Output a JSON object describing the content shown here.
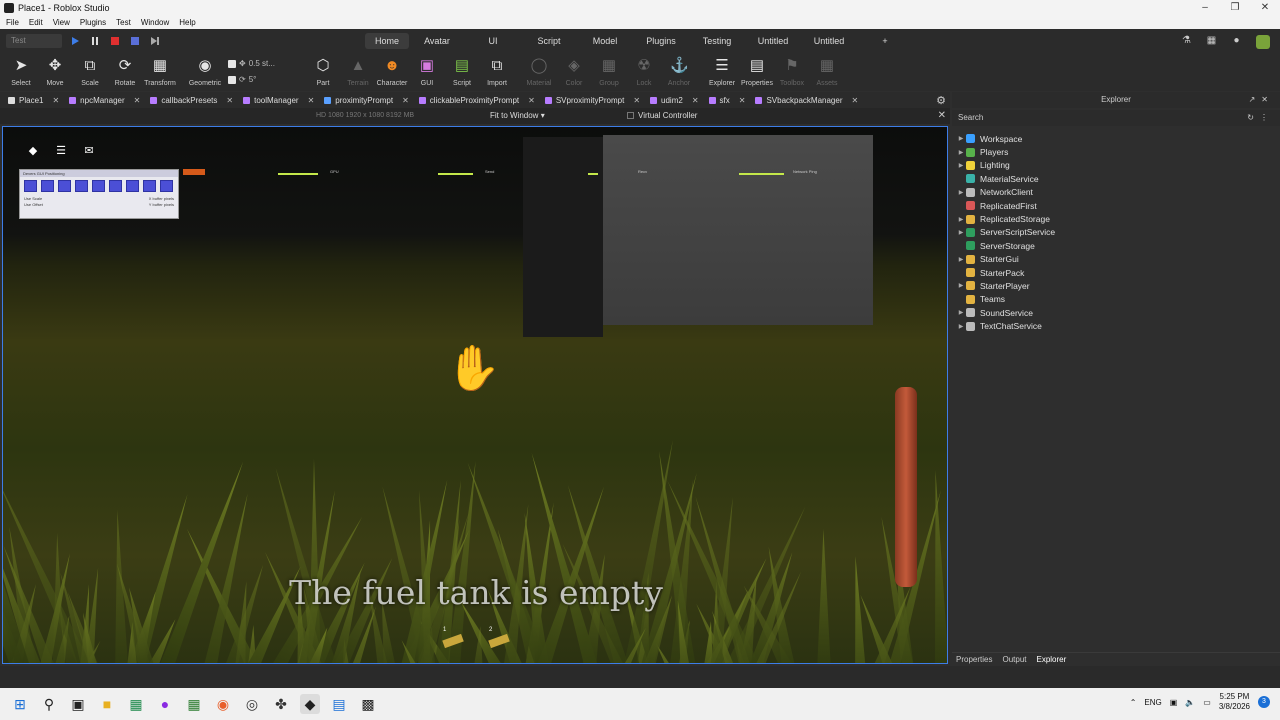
{
  "window": {
    "title": "Place1 - Roblox Studio"
  },
  "menu": [
    "File",
    "Edit",
    "View",
    "Plugins",
    "Test",
    "Window",
    "Help"
  ],
  "playbar": {
    "mode_label": "Test"
  },
  "ribbon_tabs": [
    {
      "label": "Home",
      "active": true
    },
    {
      "label": "Avatar"
    },
    {
      "label": "UI"
    },
    {
      "label": "Script"
    },
    {
      "label": "Model"
    },
    {
      "label": "Plugins"
    },
    {
      "label": "Testing"
    },
    {
      "label": "Untitled"
    },
    {
      "label": "Untitled"
    },
    {
      "label": "+"
    }
  ],
  "tools": {
    "select": "Select",
    "move": "Move",
    "scale": "Scale",
    "rotate": "Rotate",
    "transform": "Transform",
    "geometric": "Geometric",
    "part": "Part",
    "terrain": "Terrain",
    "character": "Character",
    "gui": "GUI",
    "script": "Script",
    "import": "Import",
    "material": "Material",
    "color": "Color",
    "group": "Group",
    "lock": "Lock",
    "anchor": "Anchor",
    "explorer": "Explorer",
    "properties": "Properties",
    "toolbox": "Toolbox",
    "assets": "Assets",
    "move_snap": "0.5 st...",
    "rotate_snap": "5°"
  },
  "doc_tabs": [
    {
      "label": "Place1"
    },
    {
      "label": "npcManager"
    },
    {
      "label": "callbackPresets"
    },
    {
      "label": "toolManager"
    },
    {
      "label": "proximityPrompt"
    },
    {
      "label": "clickableProximityPrompt"
    },
    {
      "label": "SVproximityPrompt"
    },
    {
      "label": "udim2"
    },
    {
      "label": "sfx"
    },
    {
      "label": "SVbackpackManager"
    }
  ],
  "viewport_bar": {
    "resolution": "HD 1080   1920 x 1080   8192 MB",
    "fit": "Fit to Window",
    "virtual_controller": "Virtual Controller"
  },
  "game": {
    "subtitle": "The fuel tank is empty",
    "stats": {
      "gpu": "GPU",
      "send": "Send",
      "recv": "Recv",
      "ping": "Network Ping"
    },
    "gui_panel": {
      "title": "Devers GUI Positioning",
      "use_scale": "Use Scale",
      "use_offset": "Use Offset",
      "x_buffer": "X buffer pixels",
      "y_buffer": "Y buffer pixels"
    },
    "hotbar": [
      "1",
      "2"
    ]
  },
  "explorer": {
    "title": "Explorer",
    "search_placeholder": "Search",
    "items": [
      {
        "label": "Workspace",
        "expandable": true,
        "color": "#3aa0ff"
      },
      {
        "label": "Players",
        "expandable": true,
        "color": "#58b24b"
      },
      {
        "label": "Lighting",
        "expandable": true,
        "color": "#f0d23a"
      },
      {
        "label": "MaterialService",
        "expandable": false,
        "color": "#3ab2a8"
      },
      {
        "label": "NetworkClient",
        "expandable": true,
        "color": "#bbbbbb"
      },
      {
        "label": "ReplicatedFirst",
        "expandable": false,
        "color": "#d95757"
      },
      {
        "label": "ReplicatedStorage",
        "expandable": true,
        "color": "#e3b341"
      },
      {
        "label": "ServerScriptService",
        "expandable": true,
        "color": "#2e9e5e"
      },
      {
        "label": "ServerStorage",
        "expandable": false,
        "color": "#2e9e5e"
      },
      {
        "label": "StarterGui",
        "expandable": true,
        "color": "#e3b341"
      },
      {
        "label": "StarterPack",
        "expandable": false,
        "color": "#e3b341"
      },
      {
        "label": "StarterPlayer",
        "expandable": true,
        "color": "#e3b341"
      },
      {
        "label": "Teams",
        "expandable": false,
        "color": "#e3b341"
      },
      {
        "label": "SoundService",
        "expandable": true,
        "color": "#bbbbbb"
      },
      {
        "label": "TextChatService",
        "expandable": true,
        "color": "#bbbbbb"
      }
    ],
    "bottom_tabs": [
      {
        "label": "Properties"
      },
      {
        "label": "Output"
      },
      {
        "label": "Explorer",
        "active": true
      }
    ]
  },
  "taskbar": {
    "language": "ENG",
    "time": "5:25 PM",
    "date": "3/8/2026",
    "notifications": "3"
  }
}
